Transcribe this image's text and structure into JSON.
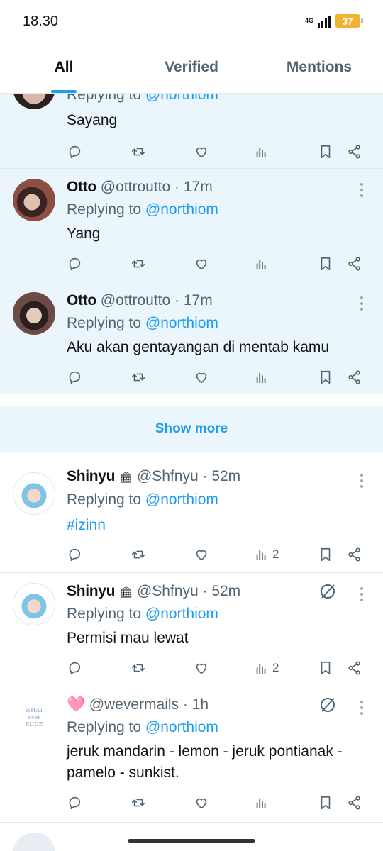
{
  "status": {
    "time": "18.30",
    "network": "4G",
    "battery": "37"
  },
  "tabs": [
    {
      "label": "All",
      "active": true
    },
    {
      "label": "Verified",
      "active": false
    },
    {
      "label": "Mentions",
      "active": false
    }
  ],
  "show_more": "Show more",
  "tweets": [
    {
      "name": "",
      "handle": "",
      "time": "",
      "replying_prefix": "Replying to",
      "mention": "@northiom",
      "text": "Sayang",
      "views": ""
    },
    {
      "name": "Otto",
      "handle": "@ottroutto",
      "time": "17m",
      "replying_prefix": "Replying to",
      "mention": "@northiom",
      "text": "Yang",
      "views": ""
    },
    {
      "name": "Otto",
      "handle": "@ottroutto",
      "time": "17m",
      "replying_prefix": "Replying to",
      "mention": "@northiom",
      "text": "Aku akan gentayangan di mentab kamu",
      "views": ""
    },
    {
      "name": "Shinyu",
      "badge": "🏛",
      "handle": "@Shfnyu",
      "time": "52m",
      "replying_prefix": "Replying to",
      "mention": "@northiom",
      "text": "#izinn",
      "views": "2"
    },
    {
      "name": "Shinyu",
      "badge": "🏛",
      "handle": "@Shfnyu",
      "time": "52m",
      "replying_prefix": "Replying to",
      "mention": "@northiom",
      "text": "Permisi mau lewat",
      "views": "2"
    },
    {
      "name": "🩷",
      "handle": "@wevermails",
      "time": "1h",
      "replying_prefix": "Replying to",
      "mention": "@northiom",
      "text": "jeruk mandarin - lemon - jeruk pontianak - pamelo - sunkist.",
      "views": "",
      "avatar_text": "WHAT ever RUDE"
    }
  ],
  "colors": {
    "accent": "#1d9bf0",
    "highlight_bg": "#eaf6fb",
    "muted": "#536471"
  },
  "icons": [
    "reply-icon",
    "retweet-icon",
    "like-icon",
    "views-icon",
    "bookmark-icon",
    "share-icon",
    "more-icon",
    "muted-icon"
  ]
}
